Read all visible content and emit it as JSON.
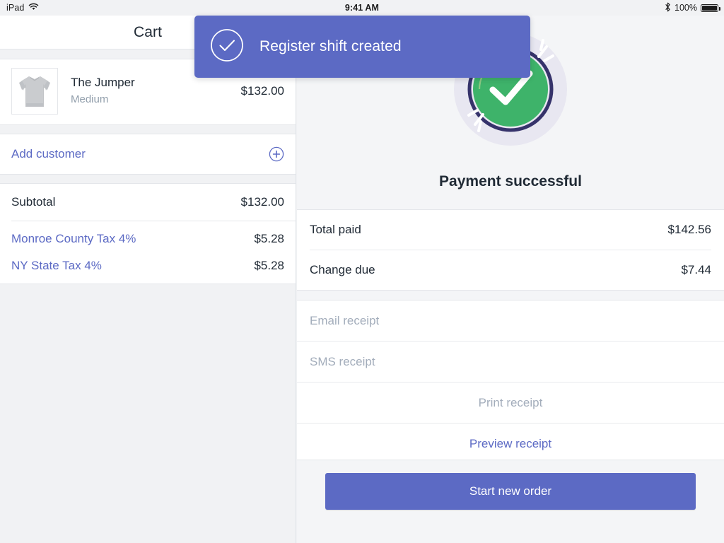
{
  "statusbar": {
    "device": "iPad",
    "wifi_icon": "wifi-icon",
    "time": "9:41 AM",
    "bluetooth_icon": "bluetooth-icon",
    "battery_percent": "100%",
    "battery_icon": "battery-full-icon"
  },
  "toast": {
    "icon": "circle-check-icon",
    "message": "Register shift created",
    "background": "#5c6ac4",
    "text_color": "#ffffff"
  },
  "cart": {
    "title": "Cart",
    "item": {
      "image": "gray-sweatshirt-thumbnail",
      "name": "The Jumper",
      "variant": "Medium",
      "price": "$132.00"
    },
    "add_customer": {
      "label": "Add customer",
      "icon": "circle-plus-icon",
      "color": "#5c6ac4"
    },
    "subtotal": {
      "label": "Subtotal",
      "value": "$132.00"
    },
    "taxes": [
      {
        "label": "Monroe County Tax 4%",
        "value": "$5.28"
      },
      {
        "label": "NY State Tax 4%",
        "value": "$5.28"
      }
    ]
  },
  "payment": {
    "status_icon": "green-check-badge-icon",
    "status_title": "Payment successful",
    "totals": [
      {
        "label": "Total paid",
        "value": "$142.56"
      },
      {
        "label": "Change due",
        "value": "$7.44"
      }
    ],
    "receipt_inputs": [
      {
        "name": "email-receipt-input",
        "placeholder": "Email receipt",
        "value": ""
      },
      {
        "name": "sms-receipt-input",
        "placeholder": "SMS receipt",
        "value": ""
      }
    ],
    "actions": [
      {
        "name": "print-receipt-button",
        "label": "Print receipt",
        "state": "disabled"
      },
      {
        "name": "preview-receipt-button",
        "label": "Preview receipt",
        "state": "enabled"
      }
    ],
    "primary_action": {
      "label": "Start new order",
      "background": "#5c6ac4"
    }
  },
  "colors": {
    "accent_indigo": "#5c6ac4",
    "success_green": "#3eb36a",
    "badge_ring": "#36336b",
    "text_dark": "#212b36",
    "text_muted": "#919eab",
    "placeholder": "#a3adbb",
    "surface": "#ffffff",
    "background": "#f1f2f4"
  }
}
